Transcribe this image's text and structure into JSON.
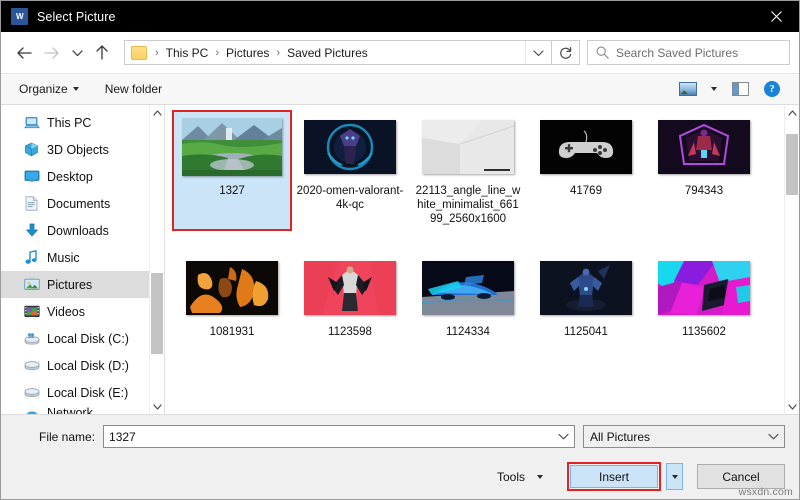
{
  "window": {
    "title": "Select Picture",
    "app_icon": "word-icon",
    "close_label": "✕"
  },
  "navbar": {
    "back": "back-arrow",
    "forward": "forward-arrow",
    "recent": "recent-locations-chevron",
    "up": "up-arrow",
    "breadcrumbs": [
      "This PC",
      "Pictures",
      "Saved Pictures"
    ],
    "separator": "›",
    "refresh": "refresh-icon",
    "search_placeholder": "Search Saved Pictures"
  },
  "toolbar": {
    "organize_label": "Organize",
    "new_folder_label": "New folder",
    "view_icon": "view-mode-icon",
    "preview_pane_icon": "preview-pane-icon",
    "help_label": "?"
  },
  "sidebar": {
    "items": [
      {
        "label": "This PC",
        "icon": "this-pc-icon",
        "selected": false
      },
      {
        "label": "3D Objects",
        "icon": "3d-objects-icon",
        "selected": false
      },
      {
        "label": "Desktop",
        "icon": "desktop-icon",
        "selected": false
      },
      {
        "label": "Documents",
        "icon": "documents-icon",
        "selected": false
      },
      {
        "label": "Downloads",
        "icon": "downloads-icon",
        "selected": false
      },
      {
        "label": "Music",
        "icon": "music-icon",
        "selected": false
      },
      {
        "label": "Pictures",
        "icon": "pictures-icon",
        "selected": true
      },
      {
        "label": "Videos",
        "icon": "videos-icon",
        "selected": false
      },
      {
        "label": "Local Disk (C:)",
        "icon": "system-drive-icon",
        "selected": false
      },
      {
        "label": "Local Disk (D:)",
        "icon": "drive-icon",
        "selected": false
      },
      {
        "label": "Local Disk (E:)",
        "icon": "drive-icon",
        "selected": false
      },
      {
        "label": "Network",
        "icon": "network-icon",
        "selected": false
      }
    ]
  },
  "files": [
    {
      "name": "1327",
      "selected": true,
      "annotated": true,
      "thumb": "landscape-waterfall"
    },
    {
      "name": "2020-omen-valorant-4k-qc",
      "selected": false,
      "annotated": false,
      "thumb": "valorant-omen"
    },
    {
      "name": "22113_angle_line_white_minimalist_66199_2560x1600",
      "selected": false,
      "annotated": false,
      "thumb": "white-minimal-corner"
    },
    {
      "name": "41769",
      "selected": false,
      "annotated": false,
      "thumb": "gamepad-dark"
    },
    {
      "name": "794343",
      "selected": false,
      "annotated": false,
      "thumb": "neon-purple-figure"
    },
    {
      "name": "1081931",
      "selected": false,
      "annotated": false,
      "thumb": "orange-abstract"
    },
    {
      "name": "1123598",
      "selected": false,
      "annotated": false,
      "thumb": "red-character"
    },
    {
      "name": "1124334",
      "selected": false,
      "annotated": false,
      "thumb": "blue-neon-car"
    },
    {
      "name": "1125041",
      "selected": false,
      "annotated": false,
      "thumb": "dark-blue-figure"
    },
    {
      "name": "1135602",
      "selected": false,
      "annotated": false,
      "thumb": "magenta-cyan-abstract"
    }
  ],
  "footer": {
    "filename_label": "File name:",
    "filename_value": "1327",
    "filter_value": "All Pictures",
    "tools_label": "Tools",
    "insert_label": "Insert",
    "cancel_label": "Cancel"
  },
  "watermark": "wsxdn.com",
  "colors": {
    "titlebar_bg": "#000000",
    "accent_blue": "#1a82d8",
    "selection_blue": "#cce4f7",
    "annotation_red": "#e02424",
    "sidebar_selected": "#dcdcdc",
    "footer_bg": "#f0f0f0"
  }
}
